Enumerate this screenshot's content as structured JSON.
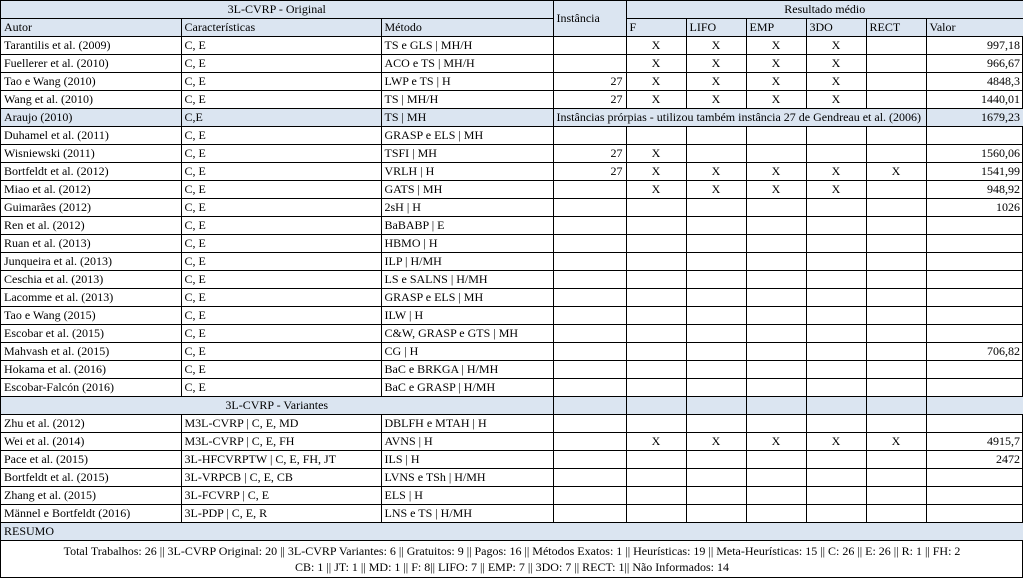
{
  "sections": {
    "original_title": "3L-CVRP - Original",
    "resultado_title": "Resultado médio",
    "variantes_title": "3L-CVRP - Variantes",
    "resumo_title": "RESUMO"
  },
  "headers": {
    "autor": "Autor",
    "caracteristicas": "Características",
    "metodo": "Método",
    "instancia": "Instância",
    "f": "F",
    "lifo": "LIFO",
    "emp": "EMP",
    "tdo": "3DO",
    "rect": "RECT",
    "valor": "Valor"
  },
  "rows_original": [
    {
      "autor": "Tarantilis et al. (2009)",
      "car": "C, E",
      "met": "TS e GLS | MH/H",
      "inst": "",
      "f": "X",
      "lifo": "X",
      "emp": "X",
      "tdo": "X",
      "rect": "",
      "valor": "997,18",
      "hl": false
    },
    {
      "autor": "Fuellerer et al. (2010)",
      "car": "C, E",
      "met": "ACO e TS | MH/H",
      "inst": "",
      "f": "X",
      "lifo": "X",
      "emp": "X",
      "tdo": "X",
      "rect": "",
      "valor": "966,67",
      "hl": false
    },
    {
      "autor": "Tao e Wang (2010)",
      "car": "C, E",
      "met": "LWP e TS | H",
      "inst": "27",
      "f": "X",
      "lifo": "X",
      "emp": "X",
      "tdo": "X",
      "rect": "",
      "valor": "4848,3",
      "hl": false
    },
    {
      "autor": "Wang et al. (2010)",
      "car": "C, E",
      "met": "TS | MH/H",
      "inst": "27",
      "f": "X",
      "lifo": "X",
      "emp": "X",
      "tdo": "X",
      "rect": "",
      "valor": "1440,01",
      "hl": false
    },
    {
      "autor": "Araujo (2010)",
      "car": "C,E",
      "met": "TS | MH",
      "inst_special": "Instâncias prórpias - utilizou também instância 27 de Gendreau et al. (2006)",
      "valor": "1679,23",
      "hl": true
    },
    {
      "autor": "Duhamel et al. (2011)",
      "car": "C, E",
      "met": "GRASP e ELS | MH",
      "inst": "",
      "f": "",
      "lifo": "",
      "emp": "",
      "tdo": "",
      "rect": "",
      "valor": "",
      "hl": false
    },
    {
      "autor": "Wisniewski (2011)",
      "car": "C, E",
      "met": "TSFI | MH",
      "inst": "27",
      "f": "X",
      "lifo": "",
      "emp": "",
      "tdo": "",
      "rect": "",
      "valor": "1560,06",
      "hl": false
    },
    {
      "autor": "Bortfeldt et al. (2012)",
      "car": "C, E",
      "met": "VRLH | H",
      "inst": "27",
      "f": "X",
      "lifo": "X",
      "emp": "X",
      "tdo": "X",
      "rect": "X",
      "valor": "1541,99",
      "hl": false
    },
    {
      "autor": "Miao et al. (2012)",
      "car": "C, E",
      "met": "GATS | MH",
      "inst": "",
      "f": "X",
      "lifo": "X",
      "emp": "X",
      "tdo": "X",
      "rect": "",
      "valor": "948,92",
      "hl": false
    },
    {
      "autor": "Guimarães (2012)",
      "car": "C, E",
      "met": "2sH | H",
      "inst": "",
      "f": "",
      "lifo": "",
      "emp": "",
      "tdo": "",
      "rect": "",
      "valor": "1026",
      "hl": false
    },
    {
      "autor": "Ren et al. (2012)",
      "car": "C, E",
      "met": "BaBABP | E",
      "inst": "",
      "f": "",
      "lifo": "",
      "emp": "",
      "tdo": "",
      "rect": "",
      "valor": "",
      "hl": false
    },
    {
      "autor": "Ruan et al. (2013)",
      "car": "C, E",
      "met": "HBMO | H",
      "inst": "",
      "f": "",
      "lifo": "",
      "emp": "",
      "tdo": "",
      "rect": "",
      "valor": "",
      "hl": false
    },
    {
      "autor": "Junqueira et al. (2013)",
      "car": "C, E",
      "met": "ILP | H/MH",
      "inst": "",
      "f": "",
      "lifo": "",
      "emp": "",
      "tdo": "",
      "rect": "",
      "valor": "",
      "hl": false
    },
    {
      "autor": "Ceschia et al. (2013)",
      "car": "C, E",
      "met": "LS e SALNS | H/MH",
      "inst": "",
      "f": "",
      "lifo": "",
      "emp": "",
      "tdo": "",
      "rect": "",
      "valor": "",
      "hl": false
    },
    {
      "autor": "Lacomme et al. (2013)",
      "car": "C, E",
      "met": "GRASP e ELS | MH",
      "inst": "",
      "f": "",
      "lifo": "",
      "emp": "",
      "tdo": "",
      "rect": "",
      "valor": "",
      "hl": false
    },
    {
      "autor": "Tao e Wang (2015)",
      "car": "C, E",
      "met": "ILW | H",
      "inst": "",
      "f": "",
      "lifo": "",
      "emp": "",
      "tdo": "",
      "rect": "",
      "valor": "",
      "hl": false
    },
    {
      "autor": "Escobar et al. (2015)",
      "car": "C, E",
      "met": "C&W, GRASP e GTS | MH",
      "inst": "",
      "f": "",
      "lifo": "",
      "emp": "",
      "tdo": "",
      "rect": "",
      "valor": "",
      "hl": false
    },
    {
      "autor": "Mahvash et al. (2015)",
      "car": "C, E",
      "met": "CG | H",
      "inst": "",
      "f": "",
      "lifo": "",
      "emp": "",
      "tdo": "",
      "rect": "",
      "valor": "706,82",
      "hl": false
    },
    {
      "autor": "Hokama et al. (2016)",
      "car": "C, E",
      "met": "BaC e BRKGA | H/MH",
      "inst": "",
      "f": "",
      "lifo": "",
      "emp": "",
      "tdo": "",
      "rect": "",
      "valor": "",
      "hl": false
    },
    {
      "autor": "Escobar-Falcón (2016)",
      "car": "C, E",
      "met": "BaC e GRASP | H/MH",
      "inst": "",
      "f": "",
      "lifo": "",
      "emp": "",
      "tdo": "",
      "rect": "",
      "valor": "",
      "hl": false
    }
  ],
  "rows_variantes": [
    {
      "autor": "Zhu et al. (2012)",
      "car": "M3L-CVRP | C, E, MD",
      "met": "DBLFH e MTAH | H",
      "inst": "",
      "f": "",
      "lifo": "",
      "emp": "",
      "tdo": "",
      "rect": "",
      "valor": ""
    },
    {
      "autor": "Wei et al. (2014)",
      "car": "M3L-CVRP | C, E, FH",
      "met": "AVNS | H",
      "inst": "",
      "f": "X",
      "lifo": "X",
      "emp": "X",
      "tdo": "X",
      "rect": "X",
      "valor": "4915,7"
    },
    {
      "autor": "Pace et al. (2015)",
      "car": "3L-HFCVRPTW | C, E, FH, JT",
      "met": "ILS | H",
      "inst": "",
      "f": "",
      "lifo": "",
      "emp": "",
      "tdo": "",
      "rect": "",
      "valor": "2472"
    },
    {
      "autor": "Bortfeldt et al. (2015)",
      "car": "3L-VRPCB | C, E, CB",
      "met": "LVNS e TSh | H/MH",
      "inst": "",
      "f": "",
      "lifo": "",
      "emp": "",
      "tdo": "",
      "rect": "",
      "valor": ""
    },
    {
      "autor": "Zhang et al. (2015)",
      "car": "3L-FCVRP | C, E",
      "met": "ELS | H",
      "inst": "",
      "f": "",
      "lifo": "",
      "emp": "",
      "tdo": "",
      "rect": "",
      "valor": ""
    },
    {
      "autor": "Männel e Bortfeldt (2016)",
      "car": "3L-PDP | C, E, R",
      "met": "LNS e TS | H/MH",
      "inst": "",
      "f": "",
      "lifo": "",
      "emp": "",
      "tdo": "",
      "rect": "",
      "valor": ""
    }
  ],
  "summary": {
    "line1": "Total Trabalhos: 26 || 3L-CVRP Original: 20 || 3L-CVRP Variantes: 6 || Gratuitos: 9 || Pagos: 16 || Métodos Exatos: 1 || Heurísticas: 19 || Meta-Heurísticas: 15 || C: 26 || E: 26 || R: 1 || FH: 2",
    "line2": "CB: 1 || JT: 1 || MD: 1 || F: 8|| LIFO: 7 || EMP: 7 || 3DO: 7 || RECT: 1|| Não Informados: 14"
  }
}
